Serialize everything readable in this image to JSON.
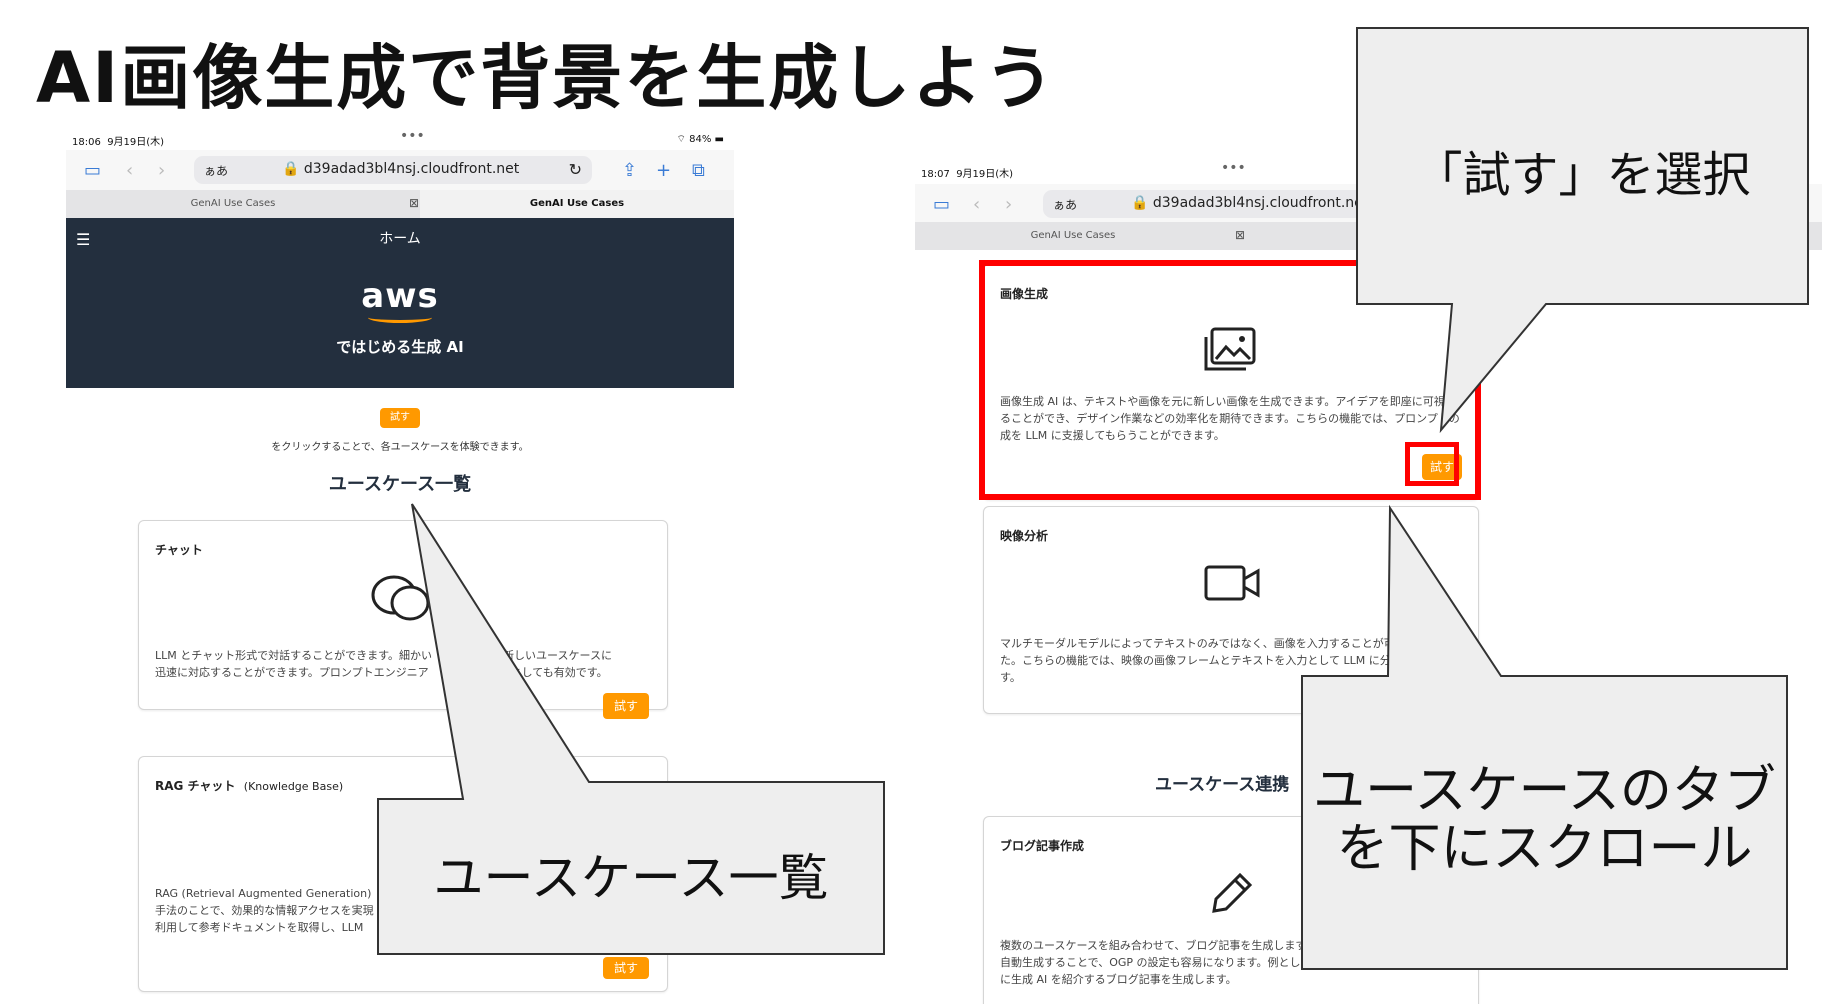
{
  "slide": {
    "title": "AI画像生成で背景を生成しよう"
  },
  "left": {
    "status": {
      "time": "18:06",
      "date": "9月19日(木)",
      "battery": "84%"
    },
    "browser": {
      "aa": "ぁあ",
      "url": "d39adad3bl4nsj.cloudfront.net",
      "tabs": [
        "GenAI Use Cases",
        "GenAI Use Cases"
      ]
    },
    "app": {
      "nav_title": "ホーム",
      "logo_text": "aws",
      "subtitle": "ではじめる生成 AI",
      "try_label": "試す",
      "hint": "をクリックすることで、各ユースケースを体験できます。",
      "section_title": "ユースケース一覧"
    },
    "cards": [
      {
        "title": "チャット",
        "desc1": "LLM とチャット形式で対話することができます。細かい",
        "desc1b": "や新しいユースケースに",
        "desc2": "迅速に対応することができます。プロンプトエンジニア",
        "desc2b": "環境としても有効です。",
        "button": "試す"
      },
      {
        "title": "RAG チャット",
        "title_sub": "(Knowledge Base)",
        "desc1": "RAG (Retrieval Augmented Generation)",
        "desc2": "手法のことで、効果的な情報アクセスを実現",
        "desc3": "利用して参考ドキュメントを取得し、LLM",
        "button": "試す"
      }
    ]
  },
  "right": {
    "status": {
      "time": "18:07",
      "date": "9月19日(木)"
    },
    "browser": {
      "aa": "ぁあ",
      "url": "d39adad3bl4nsj.cloudfront.net",
      "tabs": [
        "GenAI Use Cases"
      ]
    },
    "cards": [
      {
        "title": "画像生成",
        "desc1": "画像生成 AI は、テキストや画像を元に新しい画像を生成できます。アイデアを即座に可視化",
        "desc2": "ることができ、デザイン作業などの効率化を期待できます。こちらの機能では、プロンプトの",
        "desc3": "成を LLM に支援してもらうことができます。",
        "button": "試す"
      },
      {
        "title": "映像分析",
        "desc1": "マルチモーダルモデルによってテキストのみではなく、画像を入力することが可",
        "desc2": "た。こちらの機能では、映像の画像フレームとテキストを入力として LLM に分",
        "desc3": "す。"
      },
      {
        "title": "ブログ記事作成",
        "desc1": "複数のユースケースを組み合わせて、ブログ記事を生成します",
        "desc2": "自動生成することで、OGP の設定も容易になります。例として",
        "desc3": "に生成 AI を紹介するブログ記事を生成します。"
      }
    ],
    "section_title": "ユースケース連携"
  },
  "callouts": {
    "top_right": "「試す」を選択",
    "bottom_left": "ユースケース一覧",
    "bottom_right_line1": "ユースケースのタブ",
    "bottom_right_line2": "を下にスクロール"
  },
  "colors": {
    "aws_orange": "#ff9900",
    "header_navy": "#232f3e",
    "highlight_red": "#ff0000",
    "callout_gray": "#eeeeee"
  }
}
